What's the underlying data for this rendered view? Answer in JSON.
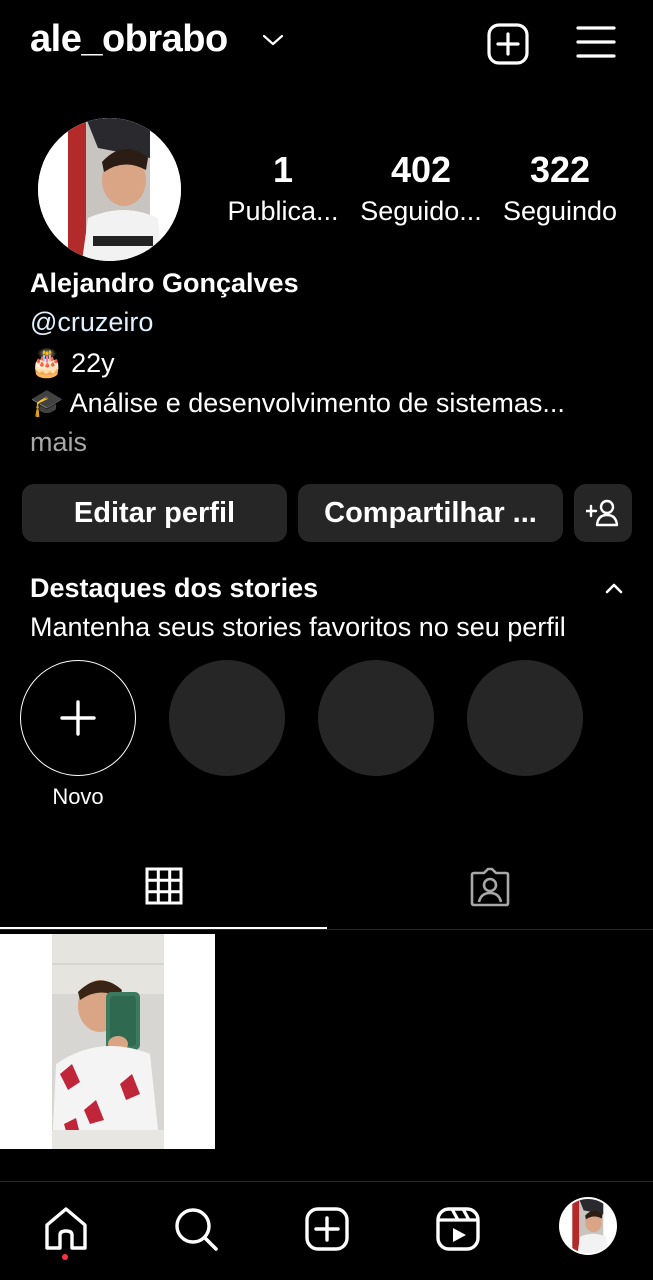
{
  "header": {
    "username": "ale_obrabo"
  },
  "profile": {
    "stats": [
      {
        "value": "1",
        "label": "Publica..."
      },
      {
        "value": "402",
        "label": "Seguido..."
      },
      {
        "value": "322",
        "label": "Seguindo"
      }
    ],
    "name": "Alejandro Gonçalves",
    "handle": "@cruzeiro",
    "bio_lines": [
      {
        "emoji": "🎂",
        "text": "22y"
      },
      {
        "emoji": "🎓",
        "text": "Análise e desenvolvimento de sistemas..."
      }
    ],
    "more_label": "mais"
  },
  "actions": {
    "edit_label": "Editar perfil",
    "share_label": "Compartilhar ..."
  },
  "highlights": {
    "title": "Destaques dos stories",
    "subtitle": "Mantenha seus stories favoritos no seu perfil",
    "new_label": "Novo"
  },
  "colors": {
    "background": "#000000",
    "surface": "#262626",
    "notification_dot": "#ff3040"
  }
}
